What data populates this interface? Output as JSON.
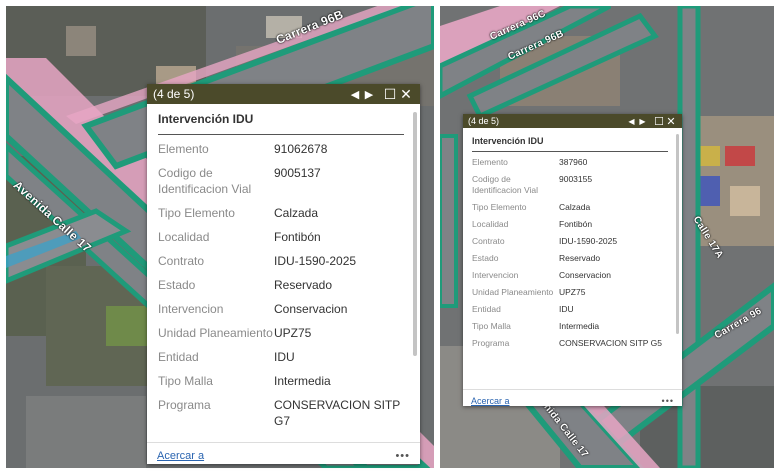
{
  "colors": {
    "header_bg": "#4b4a2a",
    "road_fill": "#7f8286",
    "road_outline": "#1f9b7a",
    "road_pink": "#e7a6c4",
    "link": "#2a64b0"
  },
  "left_map": {
    "street_labels": [
      "Carrera 96B",
      "Avenida Calle 17"
    ],
    "popup": {
      "counter": "(4 de 5)",
      "title": "Intervención IDU",
      "attributes": [
        {
          "key": "Elemento",
          "value": "91062678"
        },
        {
          "key": "Codigo de Identificacion Vial",
          "value": "9005137"
        },
        {
          "key": "Tipo Elemento",
          "value": "Calzada"
        },
        {
          "key": "Localidad",
          "value": "Fontibón"
        },
        {
          "key": "Contrato",
          "value": "IDU-1590-2025"
        },
        {
          "key": "Estado",
          "value": "Reservado"
        },
        {
          "key": "Intervencion",
          "value": "Conservacion"
        },
        {
          "key": "Unidad Planeamiento",
          "value": "UPZ75"
        },
        {
          "key": "Entidad",
          "value": "IDU"
        },
        {
          "key": "Tipo Malla",
          "value": "Intermedia"
        },
        {
          "key": "Programa",
          "value": "CONSERVACION SITP G7"
        }
      ],
      "zoom_label": "Acercar a",
      "more_label": "•••"
    }
  },
  "right_map": {
    "street_labels": [
      "Carrera 96C",
      "Carrera 96B",
      "Calle 17A",
      "Carrera 96",
      "Avenida Calle 17"
    ],
    "popup": {
      "counter": "(4 de 5)",
      "title": "Intervención IDU",
      "attributes": [
        {
          "key": "Elemento",
          "value": "387960"
        },
        {
          "key": "Codigo de Identificacion Vial",
          "value": "9003155"
        },
        {
          "key": "Tipo Elemento",
          "value": "Calzada"
        },
        {
          "key": "Localidad",
          "value": "Fontibón"
        },
        {
          "key": "Contrato",
          "value": "IDU-1590-2025"
        },
        {
          "key": "Estado",
          "value": "Reservado"
        },
        {
          "key": "Intervencion",
          "value": "Conservacion"
        },
        {
          "key": "Unidad Planeamiento",
          "value": "UPZ75"
        },
        {
          "key": "Entidad",
          "value": "IDU"
        },
        {
          "key": "Tipo Malla",
          "value": "Intermedia"
        },
        {
          "key": "Programa",
          "value": "CONSERVACION SITP G5"
        }
      ],
      "zoom_label": "Acercar a",
      "more_label": "•••"
    }
  },
  "icons": {
    "prev": "prev-icon",
    "next": "next-icon",
    "maximize": "maximize-icon",
    "close": "close-icon"
  }
}
